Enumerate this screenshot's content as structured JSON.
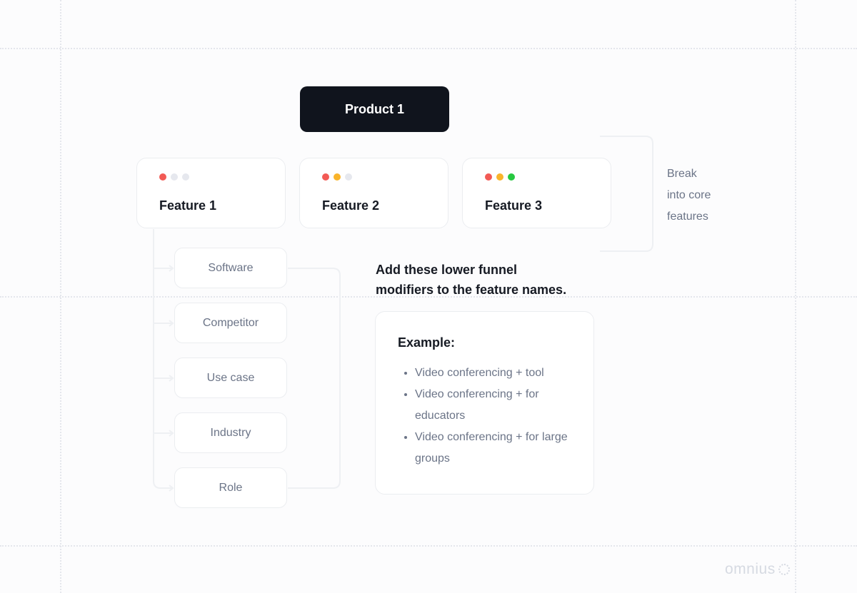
{
  "product": {
    "label": "Product 1"
  },
  "features": [
    {
      "label": "Feature 1",
      "dots": [
        "#f25a55",
        "#e6e8ee",
        "#e6e8ee"
      ]
    },
    {
      "label": "Feature 2",
      "dots": [
        "#f25a55",
        "#f9b42b",
        "#e6e8ee"
      ]
    },
    {
      "label": "Feature 3",
      "dots": [
        "#f25a55",
        "#f9b42b",
        "#27c840"
      ]
    }
  ],
  "side_note": {
    "lines": [
      "Break",
      "into core",
      "features"
    ]
  },
  "modifiers": [
    "Software",
    "Competitor",
    "Use case",
    "Industry",
    "Role"
  ],
  "instruction": {
    "line1": "Add these lower funnel",
    "line2": "modifiers to the feature names."
  },
  "example": {
    "title": "Example:",
    "items": [
      "Video conferencing + tool",
      "Video conferencing + for educators",
      "Video conferencing + for large groups"
    ]
  },
  "logo": {
    "text": "omnius"
  }
}
